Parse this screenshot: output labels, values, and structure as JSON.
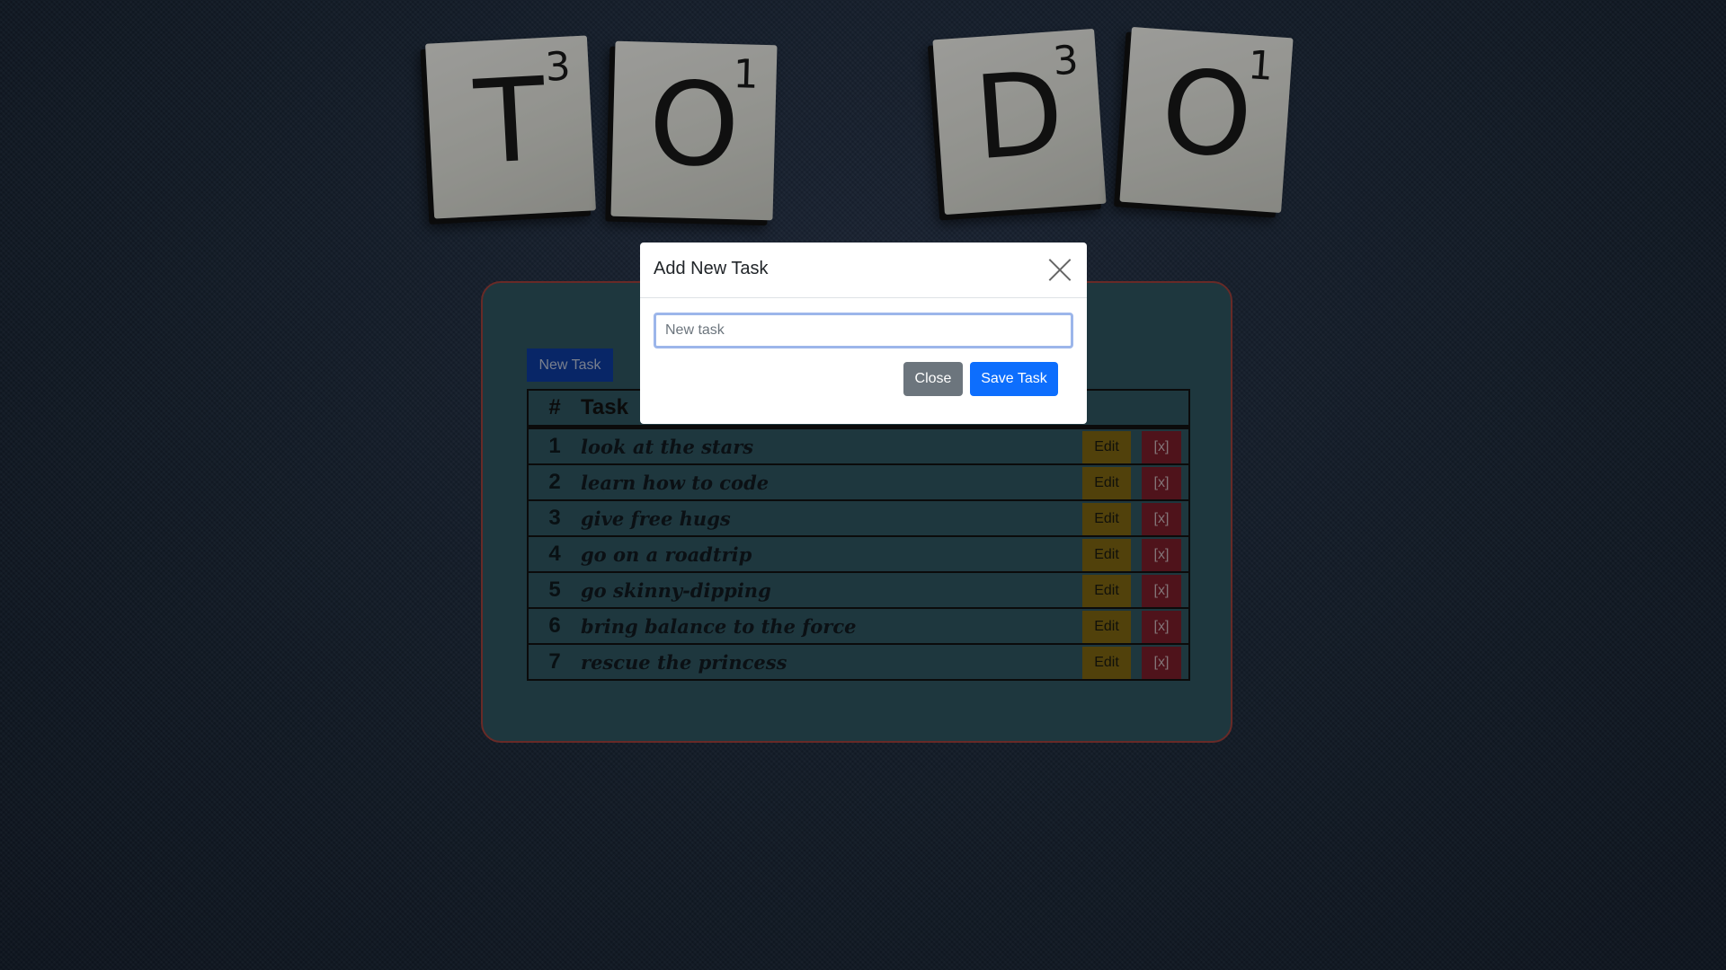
{
  "tiles": [
    {
      "letter": "T",
      "number": "3"
    },
    {
      "letter": "O",
      "number": "1"
    },
    {
      "letter": "D",
      "number": "3"
    },
    {
      "letter": "O",
      "number": "1"
    }
  ],
  "toolbar": {
    "new_task_label": "New Task"
  },
  "table": {
    "headers": {
      "num": "#",
      "task": "Task"
    },
    "rows": [
      {
        "num": "1",
        "task": "look at the stars",
        "edit": "Edit",
        "delete": "[x]"
      },
      {
        "num": "2",
        "task": "learn how to code",
        "edit": "Edit",
        "delete": "[x]"
      },
      {
        "num": "3",
        "task": "give free hugs",
        "edit": "Edit",
        "delete": "[x]"
      },
      {
        "num": "4",
        "task": "go on a roadtrip",
        "edit": "Edit",
        "delete": "[x]"
      },
      {
        "num": "5",
        "task": "go skinny-dipping",
        "edit": "Edit",
        "delete": "[x]"
      },
      {
        "num": "6",
        "task": "bring balance to the force",
        "edit": "Edit",
        "delete": "[x]"
      },
      {
        "num": "7",
        "task": "rescue the princess",
        "edit": "Edit",
        "delete": "[x]"
      }
    ]
  },
  "modal": {
    "title": "Add New Task",
    "input_value": "",
    "input_placeholder": "New task",
    "close_label": "Close",
    "save_label": "Save Task"
  },
  "colors": {
    "card_bg": "#2e5560",
    "card_border": "#a0413c",
    "edit_btn": "#7d6411",
    "delete_btn": "#7a1e2a",
    "primary": "#0d6efd",
    "secondary": "#6c757d"
  },
  "icons": {
    "modal_close": "close-icon"
  }
}
